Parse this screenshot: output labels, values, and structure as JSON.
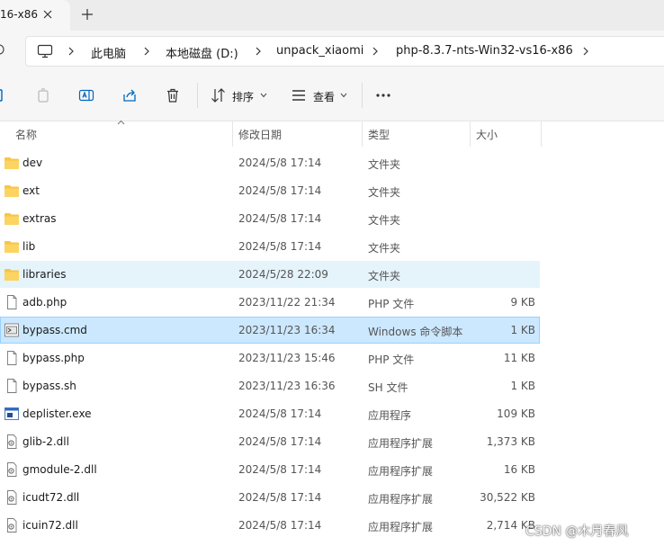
{
  "tab": {
    "title": "16-x86"
  },
  "breadcrumb": [
    "此电脑",
    "本地磁盘 (D:)",
    "unpack_xiaomi",
    "php-8.3.7-nts-Win32-vs16-x86"
  ],
  "toolbar": {
    "sort_label": "排序",
    "view_label": "查看"
  },
  "columns": {
    "name": "名称",
    "modified": "修改日期",
    "type": "类型",
    "size": "大小"
  },
  "files": [
    {
      "name": "dev",
      "modified": "2024/5/8 17:14",
      "type": "文件夹",
      "size": "",
      "icon": "folder-icon"
    },
    {
      "name": "ext",
      "modified": "2024/5/8 17:14",
      "type": "文件夹",
      "size": "",
      "icon": "folder-icon"
    },
    {
      "name": "extras",
      "modified": "2024/5/8 17:14",
      "type": "文件夹",
      "size": "",
      "icon": "folder-icon"
    },
    {
      "name": "lib",
      "modified": "2024/5/8 17:14",
      "type": "文件夹",
      "size": "",
      "icon": "folder-icon"
    },
    {
      "name": "libraries",
      "modified": "2024/5/28 22:09",
      "type": "文件夹",
      "size": "",
      "icon": "folder-icon",
      "state": "hover"
    },
    {
      "name": "adb.php",
      "modified": "2023/11/22 21:34",
      "type": "PHP 文件",
      "size": "9 KB",
      "icon": "file-icon"
    },
    {
      "name": "bypass.cmd",
      "modified": "2023/11/23 16:34",
      "type": "Windows 命令脚本",
      "size": "1 KB",
      "icon": "cmd-script-icon",
      "state": "selected"
    },
    {
      "name": "bypass.php",
      "modified": "2023/11/23 15:46",
      "type": "PHP 文件",
      "size": "11 KB",
      "icon": "file-icon"
    },
    {
      "name": "bypass.sh",
      "modified": "2023/11/23 16:36",
      "type": "SH 文件",
      "size": "1 KB",
      "icon": "file-icon"
    },
    {
      "name": "deplister.exe",
      "modified": "2024/5/8 17:14",
      "type": "应用程序",
      "size": "109 KB",
      "icon": "exe-icon"
    },
    {
      "name": "glib-2.dll",
      "modified": "2024/5/8 17:14",
      "type": "应用程序扩展",
      "size": "1,373 KB",
      "icon": "dll-icon"
    },
    {
      "name": "gmodule-2.dll",
      "modified": "2024/5/8 17:14",
      "type": "应用程序扩展",
      "size": "16 KB",
      "icon": "dll-icon"
    },
    {
      "name": "icudt72.dll",
      "modified": "2024/5/8 17:14",
      "type": "应用程序扩展",
      "size": "30,522 KB",
      "icon": "dll-icon"
    },
    {
      "name": "icuin72.dll",
      "modified": "2024/5/8 17:14",
      "type": "应用程序扩展",
      "size": "2,714 KB",
      "icon": "dll-icon"
    }
  ],
  "watermark": "CSDN @木月春风",
  "colors": {
    "folder": "#f8c544",
    "selected": "#cce8ff",
    "hover": "#e5f3fb",
    "accent": "#0067c0"
  }
}
